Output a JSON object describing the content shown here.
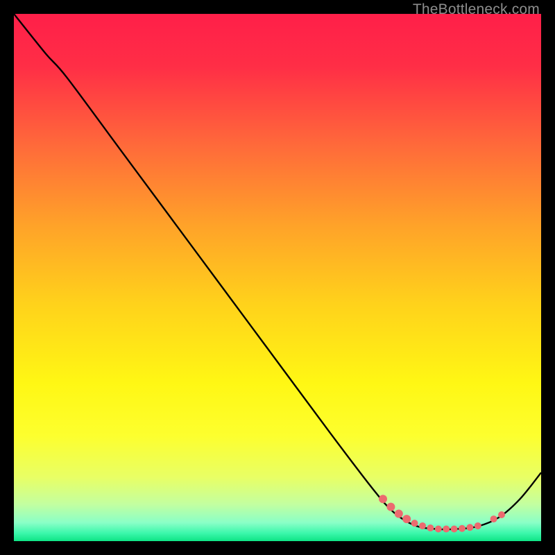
{
  "watermark": "TheBottleneck.com",
  "chart_data": {
    "type": "line",
    "title": "",
    "xlabel": "",
    "ylabel": "",
    "xlim": [
      0,
      100
    ],
    "ylim": [
      0,
      100
    ],
    "gradient_stops": [
      {
        "offset": 0.0,
        "color": "#ff1f49"
      },
      {
        "offset": 0.1,
        "color": "#ff2e46"
      },
      {
        "offset": 0.25,
        "color": "#ff6a3a"
      },
      {
        "offset": 0.4,
        "color": "#ffa229"
      },
      {
        "offset": 0.55,
        "color": "#ffd21b"
      },
      {
        "offset": 0.7,
        "color": "#fff714"
      },
      {
        "offset": 0.8,
        "color": "#fdff2e"
      },
      {
        "offset": 0.88,
        "color": "#e8ff66"
      },
      {
        "offset": 0.93,
        "color": "#c3ffa0"
      },
      {
        "offset": 0.965,
        "color": "#8affc7"
      },
      {
        "offset": 0.985,
        "color": "#3bf7ab"
      },
      {
        "offset": 1.0,
        "color": "#0ee485"
      }
    ],
    "series": [
      {
        "name": "curve",
        "points": [
          {
            "x": 0.0,
            "y": 100.0
          },
          {
            "x": 6.0,
            "y": 92.5
          },
          {
            "x": 10.0,
            "y": 88.0
          },
          {
            "x": 20.0,
            "y": 74.5
          },
          {
            "x": 30.0,
            "y": 61.0
          },
          {
            "x": 40.0,
            "y": 47.5
          },
          {
            "x": 50.0,
            "y": 34.0
          },
          {
            "x": 60.0,
            "y": 20.5
          },
          {
            "x": 68.0,
            "y": 10.0
          },
          {
            "x": 72.0,
            "y": 5.5
          },
          {
            "x": 76.0,
            "y": 3.0
          },
          {
            "x": 80.0,
            "y": 2.3
          },
          {
            "x": 84.0,
            "y": 2.3
          },
          {
            "x": 88.0,
            "y": 2.8
          },
          {
            "x": 92.0,
            "y": 4.5
          },
          {
            "x": 96.0,
            "y": 8.0
          },
          {
            "x": 100.0,
            "y": 13.0
          }
        ]
      }
    ],
    "markers": [
      {
        "x": 70.0,
        "y": 8.0,
        "r": 6
      },
      {
        "x": 71.5,
        "y": 6.5,
        "r": 6
      },
      {
        "x": 73.0,
        "y": 5.2,
        "r": 6
      },
      {
        "x": 74.5,
        "y": 4.2,
        "r": 6
      },
      {
        "x": 76.0,
        "y": 3.4,
        "r": 5
      },
      {
        "x": 77.5,
        "y": 2.9,
        "r": 5
      },
      {
        "x": 79.0,
        "y": 2.5,
        "r": 5
      },
      {
        "x": 80.5,
        "y": 2.3,
        "r": 5
      },
      {
        "x": 82.0,
        "y": 2.3,
        "r": 5
      },
      {
        "x": 83.5,
        "y": 2.3,
        "r": 5
      },
      {
        "x": 85.0,
        "y": 2.4,
        "r": 5
      },
      {
        "x": 86.5,
        "y": 2.6,
        "r": 5
      },
      {
        "x": 88.0,
        "y": 2.9,
        "r": 5
      },
      {
        "x": 91.0,
        "y": 4.2,
        "r": 5
      },
      {
        "x": 92.5,
        "y": 5.0,
        "r": 5
      }
    ],
    "marker_color": "#ec6a6f",
    "curve_color": "#000000"
  }
}
